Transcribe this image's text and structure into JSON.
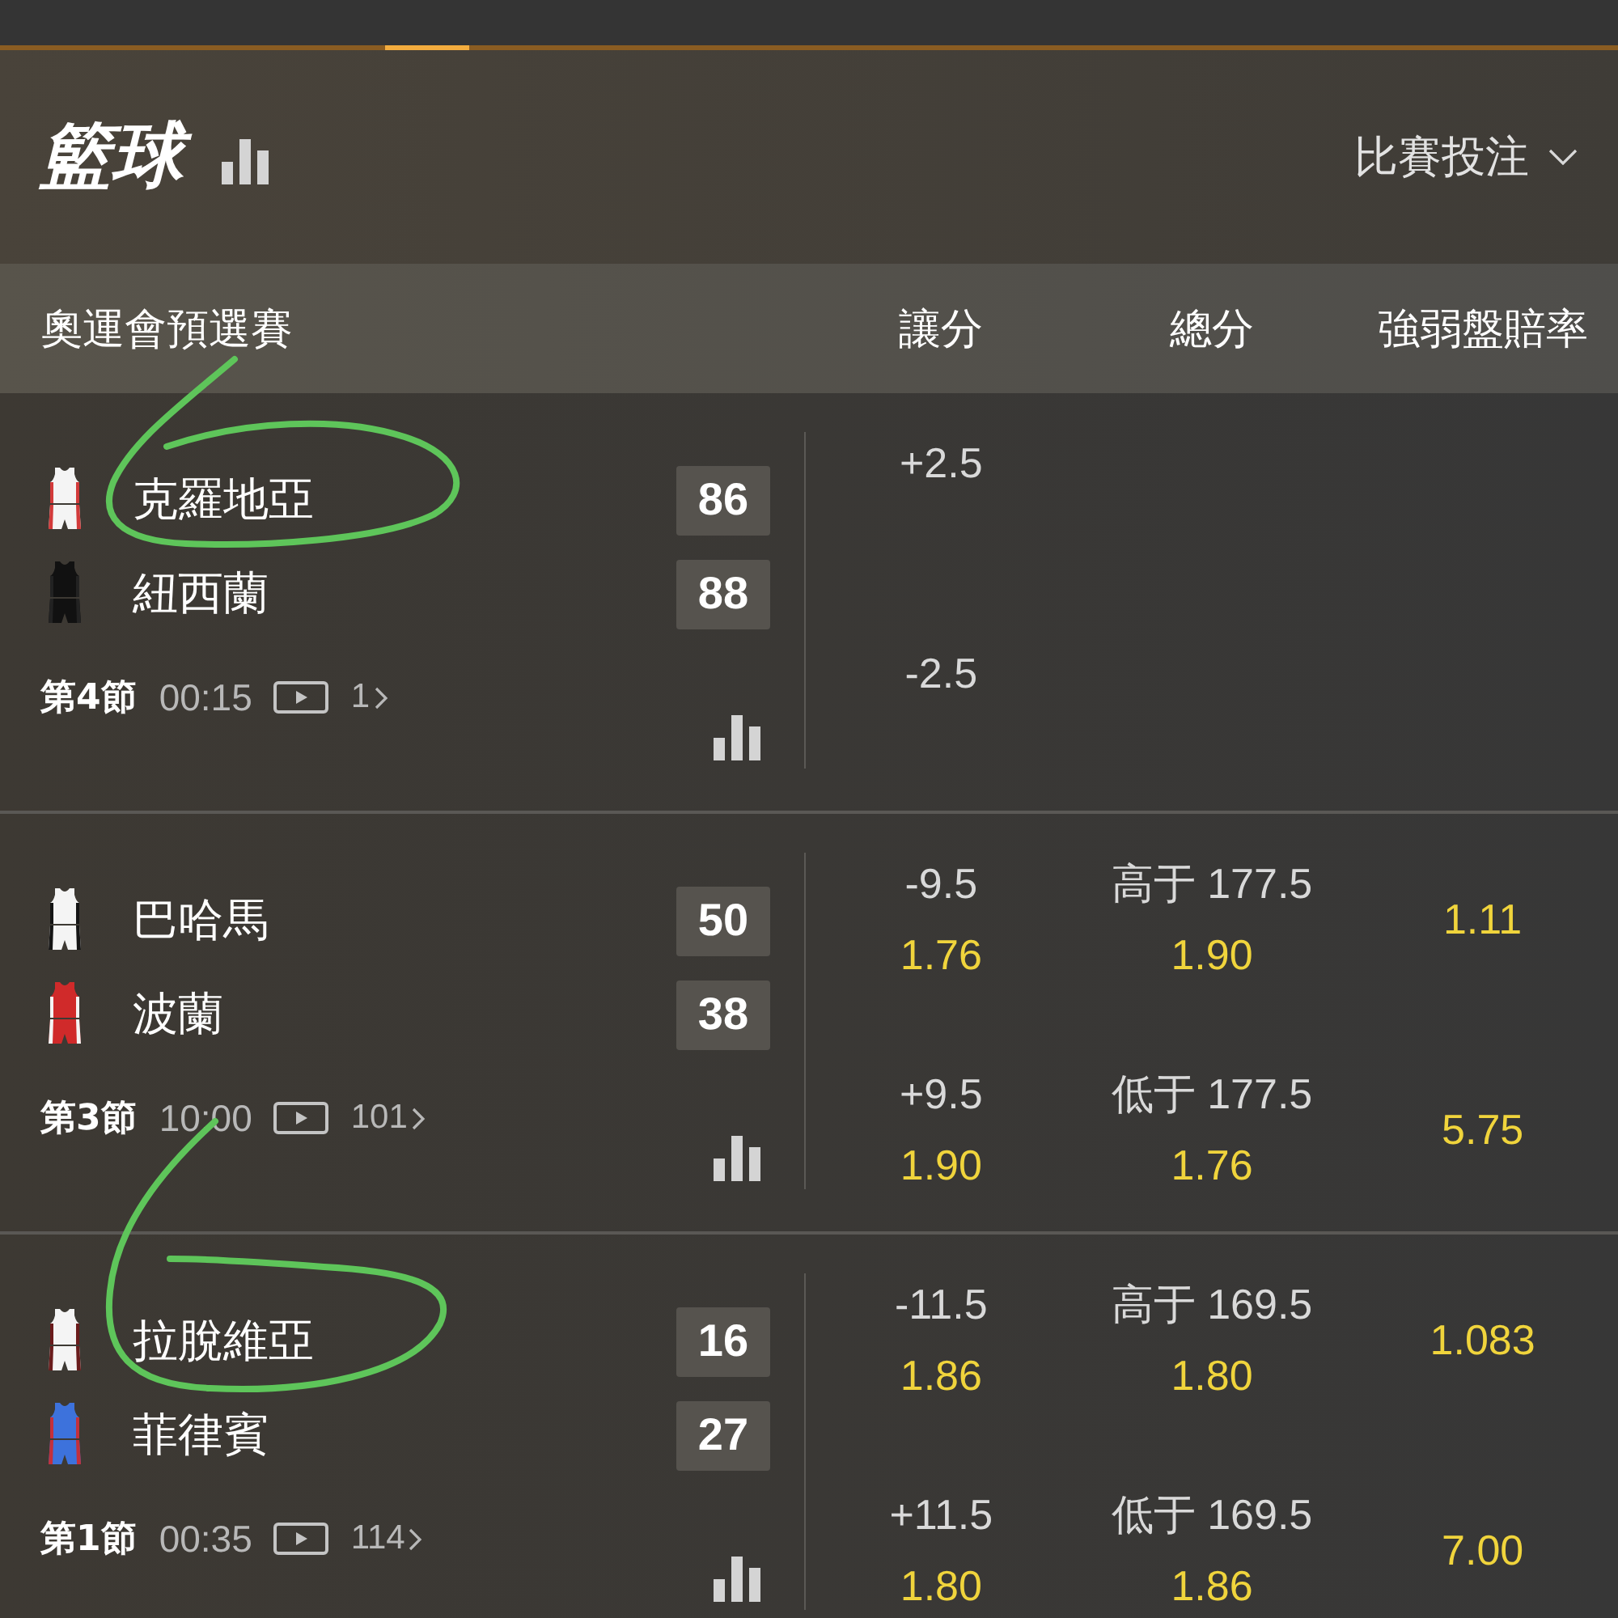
{
  "header": {
    "title": "籃球",
    "market_menu": "比賽投注"
  },
  "columns": {
    "league": "奧運會預選賽",
    "headings": [
      "讓分",
      "總分",
      "強弱盤賠率"
    ]
  },
  "matches": [
    {
      "teams": [
        {
          "name": "克羅地亞",
          "score": "86",
          "kit": [
            {
              "kind": "body",
              "color": "#f4f4f4"
            },
            {
              "kind": "trim",
              "color": "#d23a3a"
            }
          ]
        },
        {
          "name": "紐西蘭",
          "score": "88",
          "kit": [
            {
              "kind": "body",
              "color": "#111111"
            },
            {
              "kind": "trim",
              "color": "#222222"
            }
          ]
        }
      ],
      "period": "第4節",
      "clock": "00:15",
      "more": "1",
      "handicap": [
        {
          "line": "+2.5"
        },
        {
          "line": "-2.5"
        }
      ]
    },
    {
      "teams": [
        {
          "name": "巴哈馬",
          "score": "50",
          "kit": [
            {
              "kind": "body",
              "color": "#f4f4f4"
            },
            {
              "kind": "trim",
              "color": "#151515"
            }
          ]
        },
        {
          "name": "波蘭",
          "score": "38",
          "kit": [
            {
              "kind": "body",
              "color": "#d02a2a"
            },
            {
              "kind": "trim",
              "color": "#f4f4f4"
            }
          ]
        }
      ],
      "period": "第3節",
      "clock": "10:00",
      "more": "101",
      "handicap": [
        {
          "line": "-9.5",
          "odds": "1.76"
        },
        {
          "line": "+9.5",
          "odds": "1.90"
        }
      ],
      "total": [
        {
          "line": "高于 177.5",
          "odds": "1.90"
        },
        {
          "line": "低于 177.5",
          "odds": "1.76"
        }
      ],
      "moneyline": [
        {
          "odds": "1.11"
        },
        {
          "odds": "5.75"
        }
      ]
    },
    {
      "teams": [
        {
          "name": "拉脫維亞",
          "score": "16",
          "kit": [
            {
              "kind": "body",
              "color": "#f4f4f4"
            },
            {
              "kind": "trim",
              "color": "#6a1c1c"
            }
          ]
        },
        {
          "name": "菲律賓",
          "score": "27",
          "kit": [
            {
              "kind": "body",
              "color": "#3d72dc"
            },
            {
              "kind": "trim",
              "color": "#c3303c"
            }
          ]
        }
      ],
      "period": "第1節",
      "clock": "00:35",
      "more": "114",
      "handicap": [
        {
          "line": "-11.5",
          "odds": "1.86"
        },
        {
          "line": "+11.5",
          "odds": "1.80"
        }
      ],
      "total": [
        {
          "line": "高于 169.5",
          "odds": "1.80"
        },
        {
          "line": "低于 169.5",
          "odds": "1.86"
        }
      ],
      "moneyline": [
        {
          "odds": "1.083"
        },
        {
          "odds": "7.00"
        }
      ]
    }
  ]
}
